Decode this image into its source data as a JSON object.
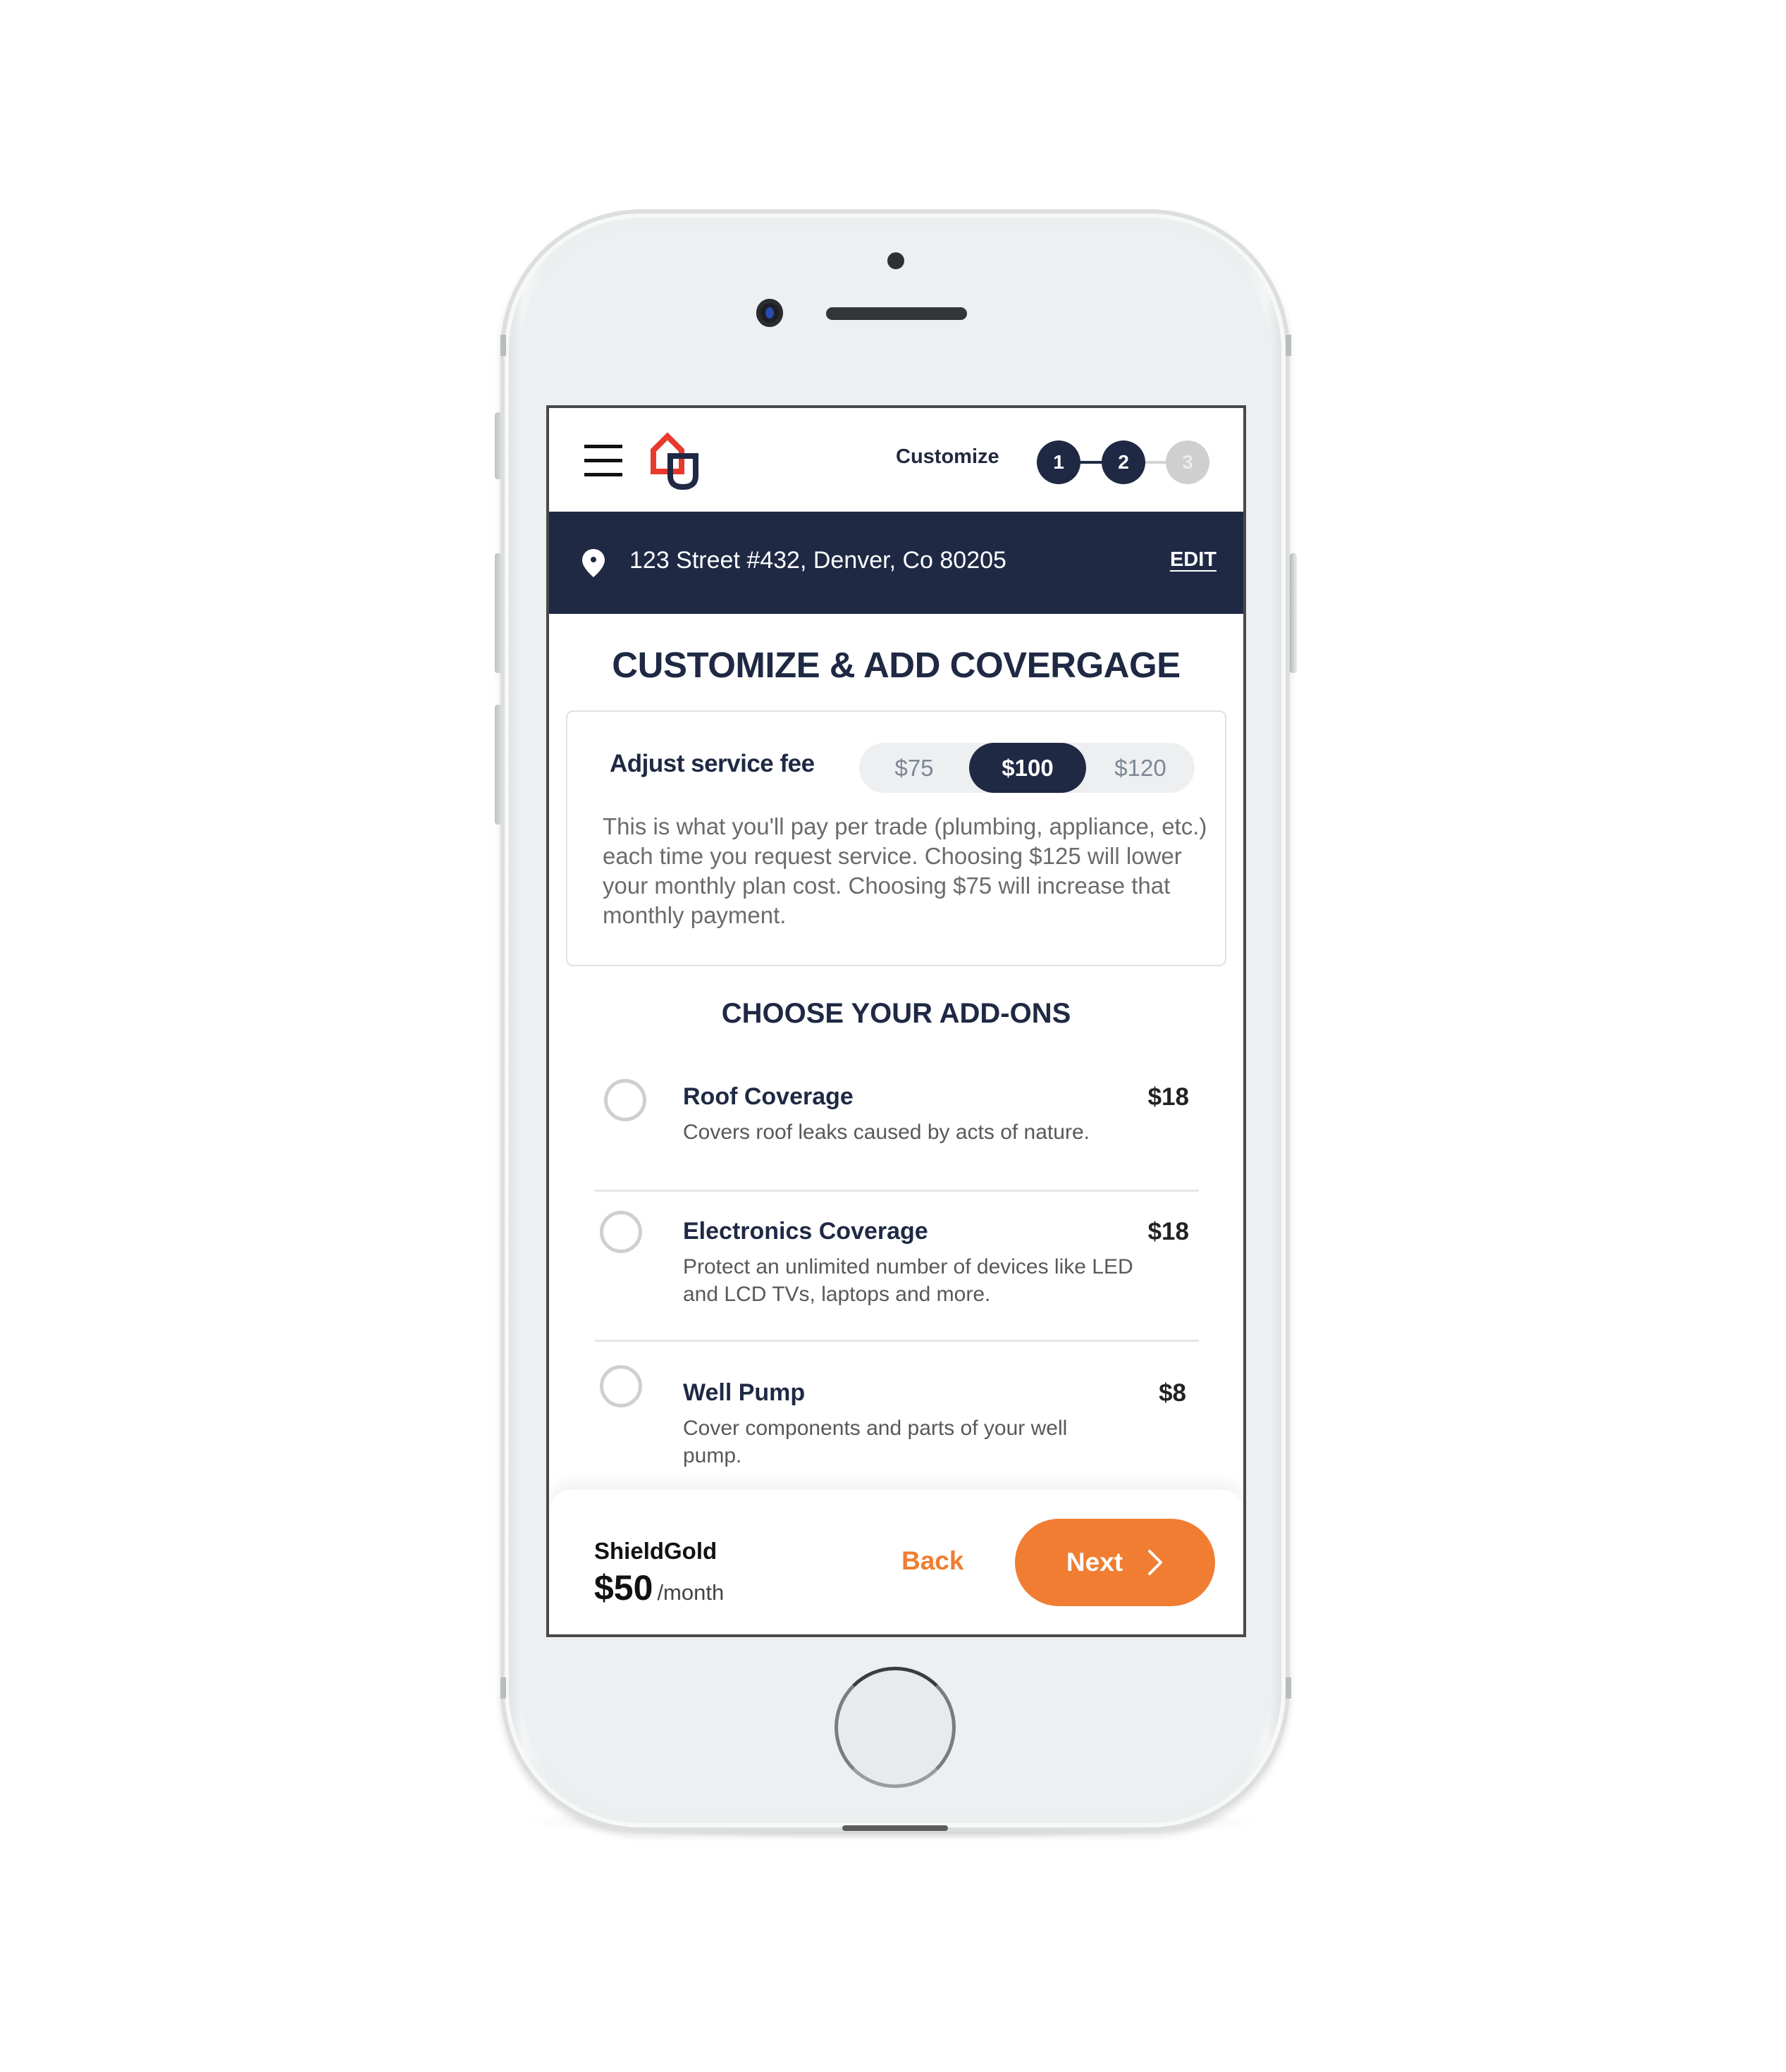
{
  "header": {
    "menu_icon": "hamburger-menu-icon",
    "logo_icon": "house-shield-logo",
    "step_label": "Customize",
    "steps": [
      {
        "label": "1",
        "state": "complete"
      },
      {
        "label": "2",
        "state": "current"
      },
      {
        "label": "3",
        "state": "upcoming"
      }
    ]
  },
  "address_bar": {
    "icon": "location-pin-icon",
    "address": "123 Street #432, Denver, Co 80205",
    "edit_label": "EDIT"
  },
  "page_title": "CUSTOMIZE & ADD COVERGAGE",
  "service_fee": {
    "label": "Adjust service fee",
    "options": [
      "$75",
      "$100",
      "$120"
    ],
    "selected": "$100",
    "description": "This is what you'll pay per trade (plumbing, appliance, etc.) each time you request service. Choosing $125 will lower your monthly plan cost. Choosing $75 will increase that monthly payment."
  },
  "addons": {
    "title": "CHOOSE YOUR ADD-ONS",
    "items": [
      {
        "title": "Roof Coverage",
        "description": "Covers roof leaks caused by acts of nature.",
        "price": "$18",
        "selected": false
      },
      {
        "title": "Electronics Coverage",
        "description": "Protect an unlimited number of devices like LED and LCD TVs, laptops and more.",
        "price": "$18",
        "selected": false
      },
      {
        "title": "Well Pump",
        "description": "Cover components and parts of your well pump.",
        "price": "$8",
        "selected": false
      }
    ]
  },
  "footer": {
    "plan_name": "ShieldGold",
    "plan_price": "$50",
    "plan_period": "/month",
    "back_label": "Back",
    "next_label": "Next",
    "next_icon": "chevron-right-icon"
  },
  "colors": {
    "navy": "#1f2944",
    "accent_orange": "#f07d32",
    "logo_red": "#e8392e",
    "step_inactive": "#cfcfcf"
  }
}
